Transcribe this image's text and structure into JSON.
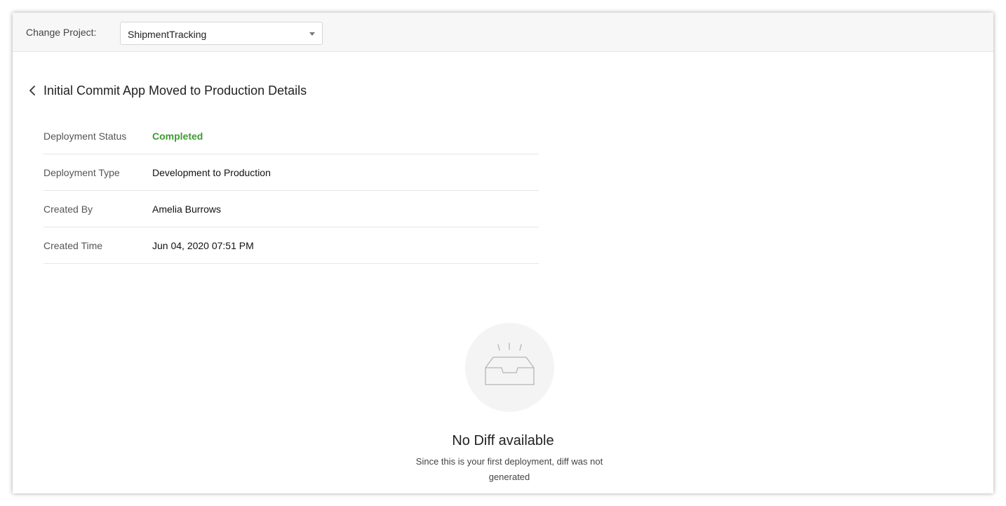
{
  "header": {
    "change_project_label": "Change Project:",
    "project_select_value": "ShipmentTracking"
  },
  "page": {
    "title": "Initial Commit App Moved to Production Details"
  },
  "details": [
    {
      "label": "Deployment Status",
      "value": "Completed",
      "value_color": "#3f9a33"
    },
    {
      "label": "Deployment Type",
      "value": "Development to Production"
    },
    {
      "label": "Created By",
      "value": "Amelia Burrows"
    },
    {
      "label": "Created Time",
      "value": "Jun 04, 2020 07:51 PM"
    }
  ],
  "empty_state": {
    "icon": "empty-tray-icon",
    "title": "No Diff available",
    "description": "Since this is your first deployment, diff was not generated"
  }
}
